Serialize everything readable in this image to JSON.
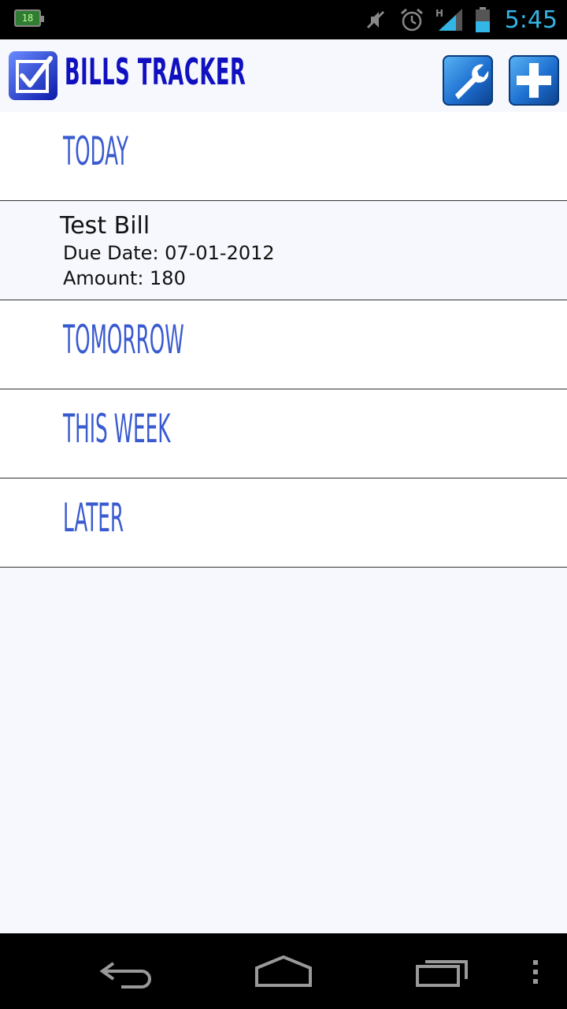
{
  "status_bar": {
    "sim_label": "18",
    "clock": "5:45",
    "signal_type": "H",
    "icons": [
      "sim-icon",
      "mute-icon",
      "alarm-icon",
      "signal-icon",
      "battery-icon"
    ],
    "accent_color": "#33b5e5"
  },
  "action_bar": {
    "title": "BILLS TRACKER",
    "icons": [
      "app-checkbox-icon",
      "wrench-icon",
      "plus-icon"
    ]
  },
  "sections": [
    {
      "title": "TODAY",
      "items": [
        {
          "name": "Test Bill",
          "due_date": "Due Date: 07-01-2012",
          "amount": "Amount: 180"
        }
      ]
    },
    {
      "title": "TOMORROW",
      "items": []
    },
    {
      "title": "THIS WEEK",
      "items": []
    },
    {
      "title": "LATER",
      "items": []
    }
  ],
  "nav_bar": {
    "icons": [
      "back-icon",
      "home-icon",
      "recent-apps-icon",
      "menu-icon"
    ]
  },
  "colors": {
    "title_blue": "#1010c0",
    "section_blue": "#3a5bd0",
    "background": "#f6f8fd"
  }
}
